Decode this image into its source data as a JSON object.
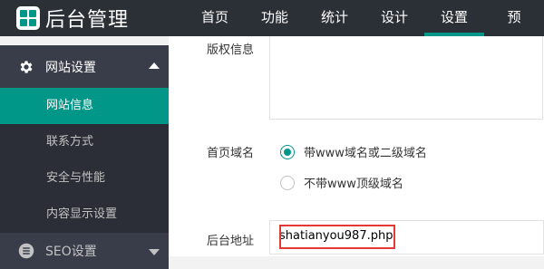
{
  "app": {
    "title": "后台管理",
    "logo": "grid-logo-icon",
    "accent": "#009688"
  },
  "nav": {
    "items": [
      {
        "label": "首页",
        "active": false
      },
      {
        "label": "功能",
        "active": false
      },
      {
        "label": "统计",
        "active": false
      },
      {
        "label": "设计",
        "active": false
      },
      {
        "label": "设置",
        "active": true
      },
      {
        "label": "预",
        "active": false
      }
    ]
  },
  "sidebar": {
    "group_site": {
      "label": "网站设置",
      "icon": "gear-icon",
      "expanded": true
    },
    "items": [
      {
        "label": "网站信息",
        "active": true
      },
      {
        "label": "联系方式",
        "active": false
      },
      {
        "label": "安全与性能",
        "active": false
      },
      {
        "label": "内容显示设置",
        "active": false
      }
    ],
    "group_seo": {
      "label": "SEO设置",
      "icon": "list-icon",
      "expanded": false
    }
  },
  "form": {
    "copyright": {
      "label": "版权信息",
      "value": ""
    },
    "domain": {
      "label": "首页域名",
      "options": [
        {
          "label": "带www域名或二级域名",
          "checked": true
        },
        {
          "label": "不带www顶级域名",
          "checked": false
        }
      ]
    },
    "admin_url": {
      "label": "后台地址",
      "value": "shatianyou987.php",
      "highlight_color": "#e53935"
    }
  }
}
